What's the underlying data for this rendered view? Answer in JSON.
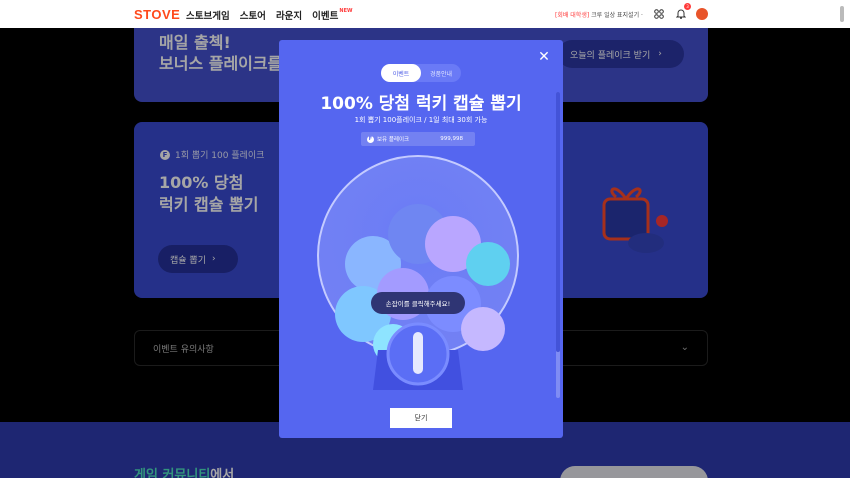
{
  "header": {
    "logo": "STOVE",
    "nav": [
      "스토브게임",
      "스토어",
      "라운지",
      "이벤트"
    ],
    "nav_new_badge": "NEW",
    "notice_tag": "[회배 대학생]",
    "notice_text": "크루 일상 표지설기 ·",
    "notification_count": "3"
  },
  "background": {
    "card1_title": "매일 출첵!\n보너스 플레이크를",
    "card1_button": "오늘의 플레이크 받기",
    "card2_sub": "1회 뽑기 100 플레이크",
    "card2_title": "100% 당첨\n럭키 캡슐 뽑기",
    "card2_button": "캡슐 뽑기",
    "notice_label": "이벤트 유의사항",
    "community_prefix": "게임 커뮤니티",
    "community_suffix": "에서"
  },
  "modal": {
    "tabs": [
      {
        "label": "이벤트",
        "active": true
      },
      {
        "label": "경품안내",
        "active": false
      }
    ],
    "title": "100% 당첨 럭키 캡슐 뽑기",
    "subtitle": "1회 뽑기 100플레이크 / 1일 최대 30회 가능",
    "points_label": "보유 플레이크",
    "points_value": "999,998",
    "hint": "손잡이를 클릭해주세요!",
    "close_button": "닫기"
  },
  "colors": {
    "brand": "#ff4a1c",
    "modal_bg": "#5566f0",
    "card_bg": "#3a4bd3"
  }
}
